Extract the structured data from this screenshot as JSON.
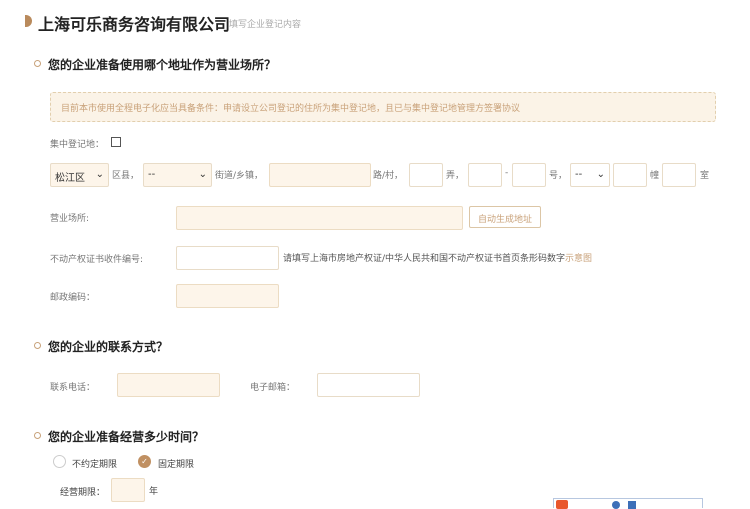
{
  "header": {
    "title": "上海可乐商务咨询有限公司",
    "subtitle": "填写企业登记内容"
  },
  "address": {
    "question": "您的企业准备使用哪个地址作为营业场所？",
    "notice": "目前本市使用全程电子化应当具备条件：申请设立公司登记的住所为集中登记地，且已与集中登记地管理方签署协议",
    "central_label": "集中登记地：",
    "district": "松江区",
    "district_suffix": "区县，",
    "street": "--",
    "street_suffix": "街道/乡镇，",
    "road_suffix": "路/村，",
    "lane_suffix": "弄，",
    "dash": "-",
    "no_suffix": "号，",
    "building_sel": "--",
    "building_suffix": "幢",
    "room_suffix": "室",
    "premises_label": "营业场所:",
    "auto_button": "自动生成地址",
    "cert_label": "不动产权证书收件编号:",
    "cert_hint": "请填写上海市房地产权证/中华人民共和国不动产权证书首页条形码数字",
    "cert_link": "示意图",
    "postal_label": "邮政编码："
  },
  "contact": {
    "question": "您的企业的联系方式？",
    "phone_label": "联系电话：",
    "email_label": "电子邮箱："
  },
  "duration": {
    "question": "您的企业准备经营多少时间？",
    "option_indef": "不约定期限",
    "option_fixed": "固定期限",
    "selected": "固定期限",
    "term_label": "经营期限：",
    "year_suffix": "年"
  }
}
